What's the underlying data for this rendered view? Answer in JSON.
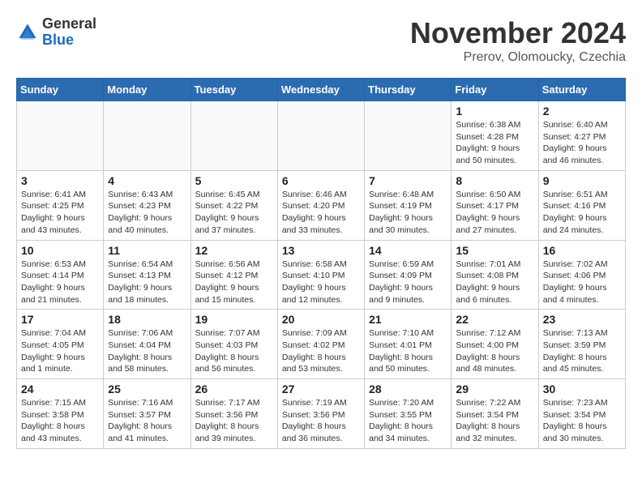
{
  "header": {
    "logo_general": "General",
    "logo_blue": "Blue",
    "month_title": "November 2024",
    "subtitle": "Prerov, Olomoucky, Czechia"
  },
  "days_of_week": [
    "Sunday",
    "Monday",
    "Tuesday",
    "Wednesday",
    "Thursday",
    "Friday",
    "Saturday"
  ],
  "weeks": [
    [
      {
        "day": "",
        "detail": ""
      },
      {
        "day": "",
        "detail": ""
      },
      {
        "day": "",
        "detail": ""
      },
      {
        "day": "",
        "detail": ""
      },
      {
        "day": "",
        "detail": ""
      },
      {
        "day": "1",
        "detail": "Sunrise: 6:38 AM\nSunset: 4:28 PM\nDaylight: 9 hours\nand 50 minutes."
      },
      {
        "day": "2",
        "detail": "Sunrise: 6:40 AM\nSunset: 4:27 PM\nDaylight: 9 hours\nand 46 minutes."
      }
    ],
    [
      {
        "day": "3",
        "detail": "Sunrise: 6:41 AM\nSunset: 4:25 PM\nDaylight: 9 hours\nand 43 minutes."
      },
      {
        "day": "4",
        "detail": "Sunrise: 6:43 AM\nSunset: 4:23 PM\nDaylight: 9 hours\nand 40 minutes."
      },
      {
        "day": "5",
        "detail": "Sunrise: 6:45 AM\nSunset: 4:22 PM\nDaylight: 9 hours\nand 37 minutes."
      },
      {
        "day": "6",
        "detail": "Sunrise: 6:46 AM\nSunset: 4:20 PM\nDaylight: 9 hours\nand 33 minutes."
      },
      {
        "day": "7",
        "detail": "Sunrise: 6:48 AM\nSunset: 4:19 PM\nDaylight: 9 hours\nand 30 minutes."
      },
      {
        "day": "8",
        "detail": "Sunrise: 6:50 AM\nSunset: 4:17 PM\nDaylight: 9 hours\nand 27 minutes."
      },
      {
        "day": "9",
        "detail": "Sunrise: 6:51 AM\nSunset: 4:16 PM\nDaylight: 9 hours\nand 24 minutes."
      }
    ],
    [
      {
        "day": "10",
        "detail": "Sunrise: 6:53 AM\nSunset: 4:14 PM\nDaylight: 9 hours\nand 21 minutes."
      },
      {
        "day": "11",
        "detail": "Sunrise: 6:54 AM\nSunset: 4:13 PM\nDaylight: 9 hours\nand 18 minutes."
      },
      {
        "day": "12",
        "detail": "Sunrise: 6:56 AM\nSunset: 4:12 PM\nDaylight: 9 hours\nand 15 minutes."
      },
      {
        "day": "13",
        "detail": "Sunrise: 6:58 AM\nSunset: 4:10 PM\nDaylight: 9 hours\nand 12 minutes."
      },
      {
        "day": "14",
        "detail": "Sunrise: 6:59 AM\nSunset: 4:09 PM\nDaylight: 9 hours\nand 9 minutes."
      },
      {
        "day": "15",
        "detail": "Sunrise: 7:01 AM\nSunset: 4:08 PM\nDaylight: 9 hours\nand 6 minutes."
      },
      {
        "day": "16",
        "detail": "Sunrise: 7:02 AM\nSunset: 4:06 PM\nDaylight: 9 hours\nand 4 minutes."
      }
    ],
    [
      {
        "day": "17",
        "detail": "Sunrise: 7:04 AM\nSunset: 4:05 PM\nDaylight: 9 hours\nand 1 minute."
      },
      {
        "day": "18",
        "detail": "Sunrise: 7:06 AM\nSunset: 4:04 PM\nDaylight: 8 hours\nand 58 minutes."
      },
      {
        "day": "19",
        "detail": "Sunrise: 7:07 AM\nSunset: 4:03 PM\nDaylight: 8 hours\nand 56 minutes."
      },
      {
        "day": "20",
        "detail": "Sunrise: 7:09 AM\nSunset: 4:02 PM\nDaylight: 8 hours\nand 53 minutes."
      },
      {
        "day": "21",
        "detail": "Sunrise: 7:10 AM\nSunset: 4:01 PM\nDaylight: 8 hours\nand 50 minutes."
      },
      {
        "day": "22",
        "detail": "Sunrise: 7:12 AM\nSunset: 4:00 PM\nDaylight: 8 hours\nand 48 minutes."
      },
      {
        "day": "23",
        "detail": "Sunrise: 7:13 AM\nSunset: 3:59 PM\nDaylight: 8 hours\nand 45 minutes."
      }
    ],
    [
      {
        "day": "24",
        "detail": "Sunrise: 7:15 AM\nSunset: 3:58 PM\nDaylight: 8 hours\nand 43 minutes."
      },
      {
        "day": "25",
        "detail": "Sunrise: 7:16 AM\nSunset: 3:57 PM\nDaylight: 8 hours\nand 41 minutes."
      },
      {
        "day": "26",
        "detail": "Sunrise: 7:17 AM\nSunset: 3:56 PM\nDaylight: 8 hours\nand 39 minutes."
      },
      {
        "day": "27",
        "detail": "Sunrise: 7:19 AM\nSunset: 3:56 PM\nDaylight: 8 hours\nand 36 minutes."
      },
      {
        "day": "28",
        "detail": "Sunrise: 7:20 AM\nSunset: 3:55 PM\nDaylight: 8 hours\nand 34 minutes."
      },
      {
        "day": "29",
        "detail": "Sunrise: 7:22 AM\nSunset: 3:54 PM\nDaylight: 8 hours\nand 32 minutes."
      },
      {
        "day": "30",
        "detail": "Sunrise: 7:23 AM\nSunset: 3:54 PM\nDaylight: 8 hours\nand 30 minutes."
      }
    ]
  ]
}
